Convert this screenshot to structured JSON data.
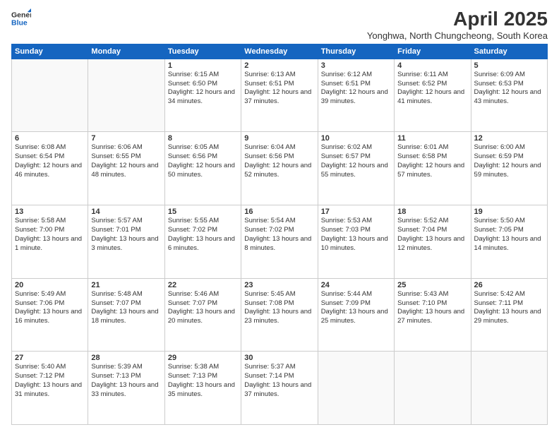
{
  "logo": {
    "general": "General",
    "blue": "Blue"
  },
  "title": "April 2025",
  "subtitle": "Yonghwa, North Chungcheong, South Korea",
  "weekdays": [
    "Sunday",
    "Monday",
    "Tuesday",
    "Wednesday",
    "Thursday",
    "Friday",
    "Saturday"
  ],
  "weeks": [
    [
      {
        "day": "",
        "info": ""
      },
      {
        "day": "",
        "info": ""
      },
      {
        "day": "1",
        "info": "Sunrise: 6:15 AM\nSunset: 6:50 PM\nDaylight: 12 hours and 34 minutes."
      },
      {
        "day": "2",
        "info": "Sunrise: 6:13 AM\nSunset: 6:51 PM\nDaylight: 12 hours and 37 minutes."
      },
      {
        "day": "3",
        "info": "Sunrise: 6:12 AM\nSunset: 6:51 PM\nDaylight: 12 hours and 39 minutes."
      },
      {
        "day": "4",
        "info": "Sunrise: 6:11 AM\nSunset: 6:52 PM\nDaylight: 12 hours and 41 minutes."
      },
      {
        "day": "5",
        "info": "Sunrise: 6:09 AM\nSunset: 6:53 PM\nDaylight: 12 hours and 43 minutes."
      }
    ],
    [
      {
        "day": "6",
        "info": "Sunrise: 6:08 AM\nSunset: 6:54 PM\nDaylight: 12 hours and 46 minutes."
      },
      {
        "day": "7",
        "info": "Sunrise: 6:06 AM\nSunset: 6:55 PM\nDaylight: 12 hours and 48 minutes."
      },
      {
        "day": "8",
        "info": "Sunrise: 6:05 AM\nSunset: 6:56 PM\nDaylight: 12 hours and 50 minutes."
      },
      {
        "day": "9",
        "info": "Sunrise: 6:04 AM\nSunset: 6:56 PM\nDaylight: 12 hours and 52 minutes."
      },
      {
        "day": "10",
        "info": "Sunrise: 6:02 AM\nSunset: 6:57 PM\nDaylight: 12 hours and 55 minutes."
      },
      {
        "day": "11",
        "info": "Sunrise: 6:01 AM\nSunset: 6:58 PM\nDaylight: 12 hours and 57 minutes."
      },
      {
        "day": "12",
        "info": "Sunrise: 6:00 AM\nSunset: 6:59 PM\nDaylight: 12 hours and 59 minutes."
      }
    ],
    [
      {
        "day": "13",
        "info": "Sunrise: 5:58 AM\nSunset: 7:00 PM\nDaylight: 13 hours and 1 minute."
      },
      {
        "day": "14",
        "info": "Sunrise: 5:57 AM\nSunset: 7:01 PM\nDaylight: 13 hours and 3 minutes."
      },
      {
        "day": "15",
        "info": "Sunrise: 5:55 AM\nSunset: 7:02 PM\nDaylight: 13 hours and 6 minutes."
      },
      {
        "day": "16",
        "info": "Sunrise: 5:54 AM\nSunset: 7:02 PM\nDaylight: 13 hours and 8 minutes."
      },
      {
        "day": "17",
        "info": "Sunrise: 5:53 AM\nSunset: 7:03 PM\nDaylight: 13 hours and 10 minutes."
      },
      {
        "day": "18",
        "info": "Sunrise: 5:52 AM\nSunset: 7:04 PM\nDaylight: 13 hours and 12 minutes."
      },
      {
        "day": "19",
        "info": "Sunrise: 5:50 AM\nSunset: 7:05 PM\nDaylight: 13 hours and 14 minutes."
      }
    ],
    [
      {
        "day": "20",
        "info": "Sunrise: 5:49 AM\nSunset: 7:06 PM\nDaylight: 13 hours and 16 minutes."
      },
      {
        "day": "21",
        "info": "Sunrise: 5:48 AM\nSunset: 7:07 PM\nDaylight: 13 hours and 18 minutes."
      },
      {
        "day": "22",
        "info": "Sunrise: 5:46 AM\nSunset: 7:07 PM\nDaylight: 13 hours and 20 minutes."
      },
      {
        "day": "23",
        "info": "Sunrise: 5:45 AM\nSunset: 7:08 PM\nDaylight: 13 hours and 23 minutes."
      },
      {
        "day": "24",
        "info": "Sunrise: 5:44 AM\nSunset: 7:09 PM\nDaylight: 13 hours and 25 minutes."
      },
      {
        "day": "25",
        "info": "Sunrise: 5:43 AM\nSunset: 7:10 PM\nDaylight: 13 hours and 27 minutes."
      },
      {
        "day": "26",
        "info": "Sunrise: 5:42 AM\nSunset: 7:11 PM\nDaylight: 13 hours and 29 minutes."
      }
    ],
    [
      {
        "day": "27",
        "info": "Sunrise: 5:40 AM\nSunset: 7:12 PM\nDaylight: 13 hours and 31 minutes."
      },
      {
        "day": "28",
        "info": "Sunrise: 5:39 AM\nSunset: 7:13 PM\nDaylight: 13 hours and 33 minutes."
      },
      {
        "day": "29",
        "info": "Sunrise: 5:38 AM\nSunset: 7:13 PM\nDaylight: 13 hours and 35 minutes."
      },
      {
        "day": "30",
        "info": "Sunrise: 5:37 AM\nSunset: 7:14 PM\nDaylight: 13 hours and 37 minutes."
      },
      {
        "day": "",
        "info": ""
      },
      {
        "day": "",
        "info": ""
      },
      {
        "day": "",
        "info": ""
      }
    ]
  ]
}
